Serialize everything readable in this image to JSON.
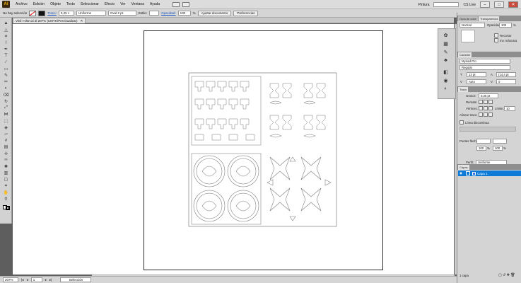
{
  "app": {
    "logo": "Ai"
  },
  "menu": [
    "Archivo",
    "Edición",
    "Objeto",
    "Texto",
    "Seleccionar",
    "Efecto",
    "Ver",
    "Ventana",
    "Ayuda"
  ],
  "window": {
    "workspace": "Pintura",
    "search_label": "CS Live",
    "minimize": "–",
    "maximize": "□",
    "close": "✕"
  },
  "control_bar": {
    "selection_state": "No hay selección",
    "stroke_label": "Trazo:",
    "stroke_weight": "0,25 c",
    "profile": "Uniforme",
    "brush": "Oval 2 pt.",
    "style_label": "Estilo:",
    "opacity_label": "Opacidad:",
    "opacity": "100",
    "opacity_unit": "%",
    "doc_setup_button": "Ajustar documento",
    "prefs_button": "Preferencias"
  },
  "document_tab": {
    "title": "Vinil t-shirt.ai al 207% (CMYK/Previsualizar)",
    "close": "✕"
  },
  "status": {
    "zoom": "207%",
    "page": "1",
    "tool": "Selección"
  },
  "panels": {
    "transparency": {
      "tabs": [
        "Guía de color",
        "Transparencia"
      ],
      "blend_mode": "Normal",
      "opacity_label": "Opacidad:",
      "opacity": "100",
      "opacity_unit": "%",
      "release": "Recortar",
      "invert": "Inv. máscara"
    },
    "character": {
      "tab": "Carácter",
      "font": "Myriad Pro",
      "style": "Regular",
      "size": "12 pt",
      "leading": "(14,4 pt",
      "kerning": "Auto",
      "tracking": "0"
    },
    "stroke": {
      "tab": "Trazo",
      "weight_label": "Grosor:",
      "weight": "0,25 pt",
      "cap_label": "Remate:",
      "corner_label": "Vértices:",
      "limit_label": "Límite:",
      "limit": "10",
      "align_label": "Alinear trazo:",
      "dashed_label": "Línea discontinua",
      "arrow_label": "Puntas flecha:",
      "scale_start": "100",
      "scale_end": "100",
      "scale_unit": "%",
      "profile_label": "Perfil:",
      "profile": "Uniforme"
    },
    "layers": {
      "tab": "Capas",
      "layer_name": "Capa 1",
      "count": "1 capa",
      "selection_color": "#0c7bd8"
    }
  },
  "tools": [
    "selection-tool",
    "direct-selection-tool",
    "magic-wand-tool",
    "lasso-tool",
    "pen-tool",
    "type-tool",
    "line-tool",
    "rectangle-tool",
    "paintbrush-tool",
    "pencil-tool",
    "blob-brush-tool",
    "eraser-tool",
    "rotate-tool",
    "scale-tool",
    "width-tool",
    "free-transform-tool",
    "shape-builder-tool",
    "perspective-tool",
    "mesh-tool",
    "gradient-tool",
    "eyedropper-tool",
    "blend-tool",
    "symbol-sprayer-tool",
    "column-graph-tool",
    "artboard-tool",
    "slice-tool",
    "hand-tool",
    "zoom-tool"
  ]
}
